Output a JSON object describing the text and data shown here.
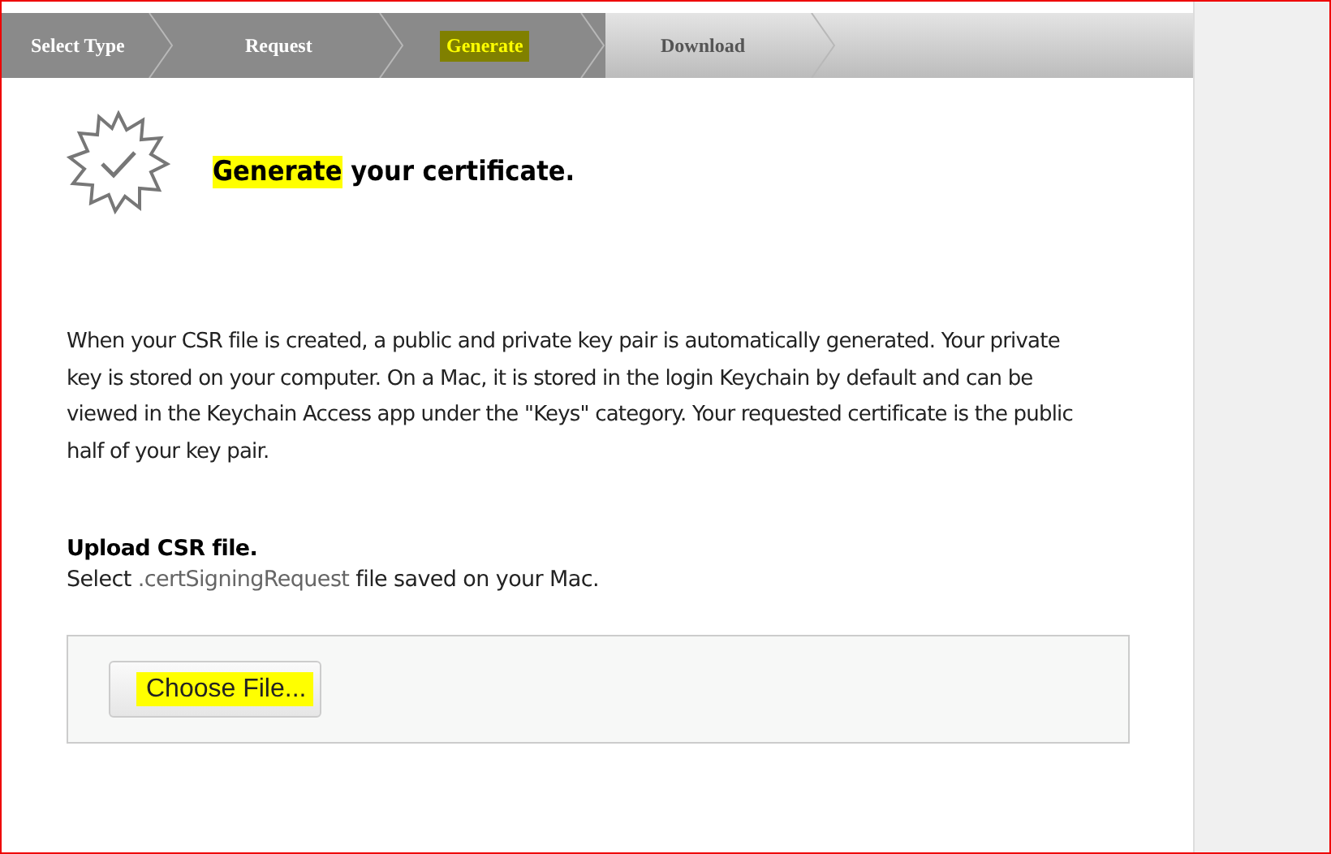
{
  "steps": [
    {
      "label": "Select Type",
      "completed": true,
      "selected": false,
      "highlighted": false
    },
    {
      "label": "Request",
      "completed": true,
      "selected": false,
      "highlighted": false
    },
    {
      "label": "Generate",
      "completed": false,
      "selected": true,
      "highlighted": true
    },
    {
      "label": "Download",
      "completed": false,
      "selected": false,
      "highlighted": false
    }
  ],
  "heading": [
    {
      "text": "Generate",
      "highlighted": true
    },
    {
      "text": " your certificate.",
      "highlighted": false
    }
  ],
  "description": "When your CSR file is created, a public and private key pair is automatically generated. Your private key is stored on your computer. On a Mac, it is stored in the login Keychain by default and can be viewed in the Keychain Access app under the \"Keys\" category. Your requested certificate is the public half of your key pair.",
  "upload": {
    "title": "Upload CSR file.",
    "instruction": [
      {
        "text": "Select ",
        "muted": false
      },
      {
        "text": ".certSigningRequest",
        "muted": true
      },
      {
        "text": " file saved on your Mac.",
        "muted": false
      }
    ],
    "button": {
      "label": "Choose File...",
      "highlighted": true
    }
  }
}
